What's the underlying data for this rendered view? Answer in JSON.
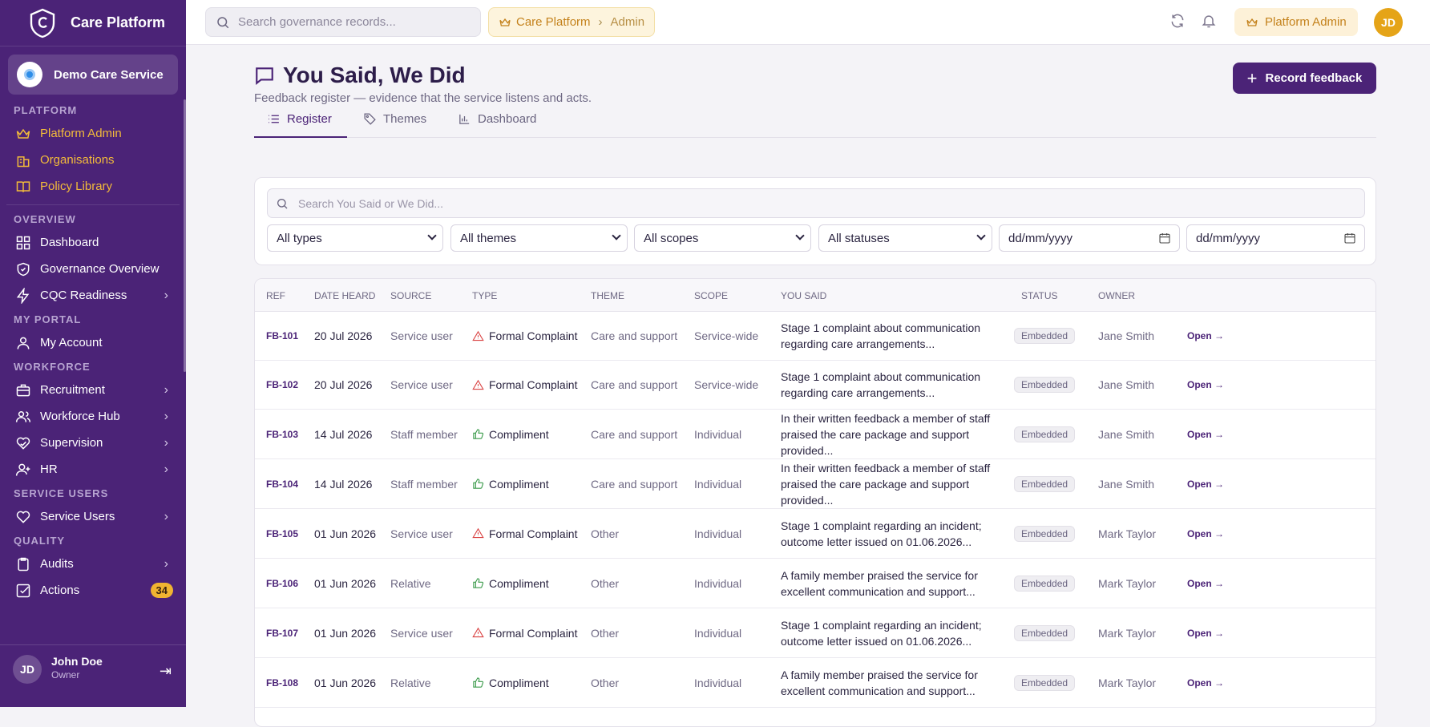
{
  "sidebar": {
    "brand": "Care Platform",
    "org": "Demo Care Service",
    "sections": [
      {
        "title": "PLATFORM",
        "items": [
          {
            "label": "Platform Admin",
            "icon": "crown-icon",
            "gold": true
          },
          {
            "label": "Organisations",
            "icon": "building-icon",
            "gold": true
          },
          {
            "label": "Policy Library",
            "icon": "book-icon",
            "gold": true
          }
        ]
      },
      {
        "title": "OVERVIEW",
        "items": [
          {
            "label": "Dashboard",
            "icon": "grid-icon"
          },
          {
            "label": "Governance Overview",
            "icon": "shield-icon"
          },
          {
            "label": "CQC Readiness",
            "icon": "bolt-icon",
            "chev": true
          }
        ]
      },
      {
        "title": "MY PORTAL",
        "items": [
          {
            "label": "My Account",
            "icon": "user-icon"
          }
        ]
      },
      {
        "title": "WORKFORCE",
        "items": [
          {
            "label": "Recruitment",
            "icon": "briefcase-icon",
            "chev": true
          },
          {
            "label": "Workforce Hub",
            "icon": "users-icon",
            "chev": true
          },
          {
            "label": "Supervision",
            "icon": "heart-hands-icon",
            "chev": true
          },
          {
            "label": "HR",
            "icon": "user-plus-icon",
            "chev": true
          }
        ]
      },
      {
        "title": "SERVICE USERS",
        "items": [
          {
            "label": "Service Users",
            "icon": "heart-icon",
            "chev": true
          }
        ]
      },
      {
        "title": "QUALITY",
        "items": [
          {
            "label": "Audits",
            "icon": "clipboard-icon",
            "chev": true
          },
          {
            "label": "Actions",
            "icon": "check-square-icon",
            "badge": "34"
          }
        ]
      }
    ],
    "user": {
      "initials": "JD",
      "name": "John Doe",
      "role": "Owner"
    }
  },
  "topbar": {
    "search_placeholder": "Search governance records...",
    "crumb_root": "Care Platform",
    "crumb_current": "Admin",
    "role_label": "Platform Admin",
    "avatar": "JD"
  },
  "page": {
    "title": "You Said, We Did",
    "subtitle": "Feedback register — evidence that the service listens and acts.",
    "record_button": "Record feedback",
    "tabs": [
      "Register",
      "Themes",
      "Dashboard"
    ]
  },
  "filters": {
    "search_placeholder": "Search You Said or We Did...",
    "selects": [
      "All types",
      "All themes",
      "All scopes",
      "All statuses"
    ],
    "dates": [
      "dd/mm/yyyy",
      "dd/mm/yyyy"
    ]
  },
  "table": {
    "headers": [
      "REF",
      "DATE HEARD",
      "SOURCE",
      "TYPE",
      "THEME",
      "SCOPE",
      "YOU SAID",
      "STATUS",
      "OWNER"
    ],
    "open_label": "Open",
    "rows": [
      {
        "ref": "FB-101",
        "date": "20 Jul 2026",
        "source": "Service user",
        "type": "Formal Complaint",
        "kind": "complaint",
        "theme": "Care and support",
        "scope": "Service-wide",
        "said1": "Stage 1 complaint about communication",
        "said2": "regarding care arrangements...",
        "status": "Embedded",
        "owner": "Jane Smith"
      },
      {
        "ref": "FB-102",
        "date": "20 Jul 2026",
        "source": "Service user",
        "type": "Formal Complaint",
        "kind": "complaint",
        "theme": "Care and support",
        "scope": "Service-wide",
        "said1": "Stage 1 complaint about communication",
        "said2": "regarding care arrangements...",
        "status": "Embedded",
        "owner": "Jane Smith"
      },
      {
        "ref": "FB-103",
        "date": "14 Jul 2026",
        "source": "Staff member",
        "type": "Compliment",
        "kind": "compliment",
        "theme": "Care and support",
        "scope": "Individual",
        "said1": "In their written feedback a member of staff",
        "said2": "praised the care package and support provided...",
        "status": "Embedded",
        "owner": "Jane Smith"
      },
      {
        "ref": "FB-104",
        "date": "14 Jul 2026",
        "source": "Staff member",
        "type": "Compliment",
        "kind": "compliment",
        "theme": "Care and support",
        "scope": "Individual",
        "said1": "In their written feedback a member of staff",
        "said2": "praised the care package and support provided...",
        "status": "Embedded",
        "owner": "Jane Smith"
      },
      {
        "ref": "FB-105",
        "date": "01 Jun 2026",
        "source": "Service user",
        "type": "Formal Complaint",
        "kind": "complaint",
        "theme": "Other",
        "scope": "Individual",
        "said1": "Stage 1 complaint regarding an incident;",
        "said2": "outcome letter issued on 01.06.2026...",
        "status": "Embedded",
        "owner": "Mark Taylor"
      },
      {
        "ref": "FB-106",
        "date": "01 Jun 2026",
        "source": "Relative",
        "type": "Compliment",
        "kind": "compliment",
        "theme": "Other",
        "scope": "Individual",
        "said1": "A family member praised the service for",
        "said2": "excellent communication and support...",
        "status": "Embedded",
        "owner": "Mark Taylor"
      },
      {
        "ref": "FB-107",
        "date": "01 Jun 2026",
        "source": "Service user",
        "type": "Formal Complaint",
        "kind": "complaint",
        "theme": "Other",
        "scope": "Individual",
        "said1": "Stage 1 complaint regarding an incident;",
        "said2": "outcome letter issued on 01.06.2026...",
        "status": "Embedded",
        "owner": "Mark Taylor"
      },
      {
        "ref": "FB-108",
        "date": "01 Jun 2026",
        "source": "Relative",
        "type": "Compliment",
        "kind": "compliment",
        "theme": "Other",
        "scope": "Individual",
        "said1": "A family member praised the service for",
        "said2": "excellent communication and support...",
        "status": "Embedded",
        "owner": "Mark Taylor"
      }
    ]
  },
  "colors": {
    "sidebar": "#4b2377",
    "accent_gold": "#f3bb3a",
    "complaint": "#d94040",
    "compliment": "#3a9a4a"
  }
}
